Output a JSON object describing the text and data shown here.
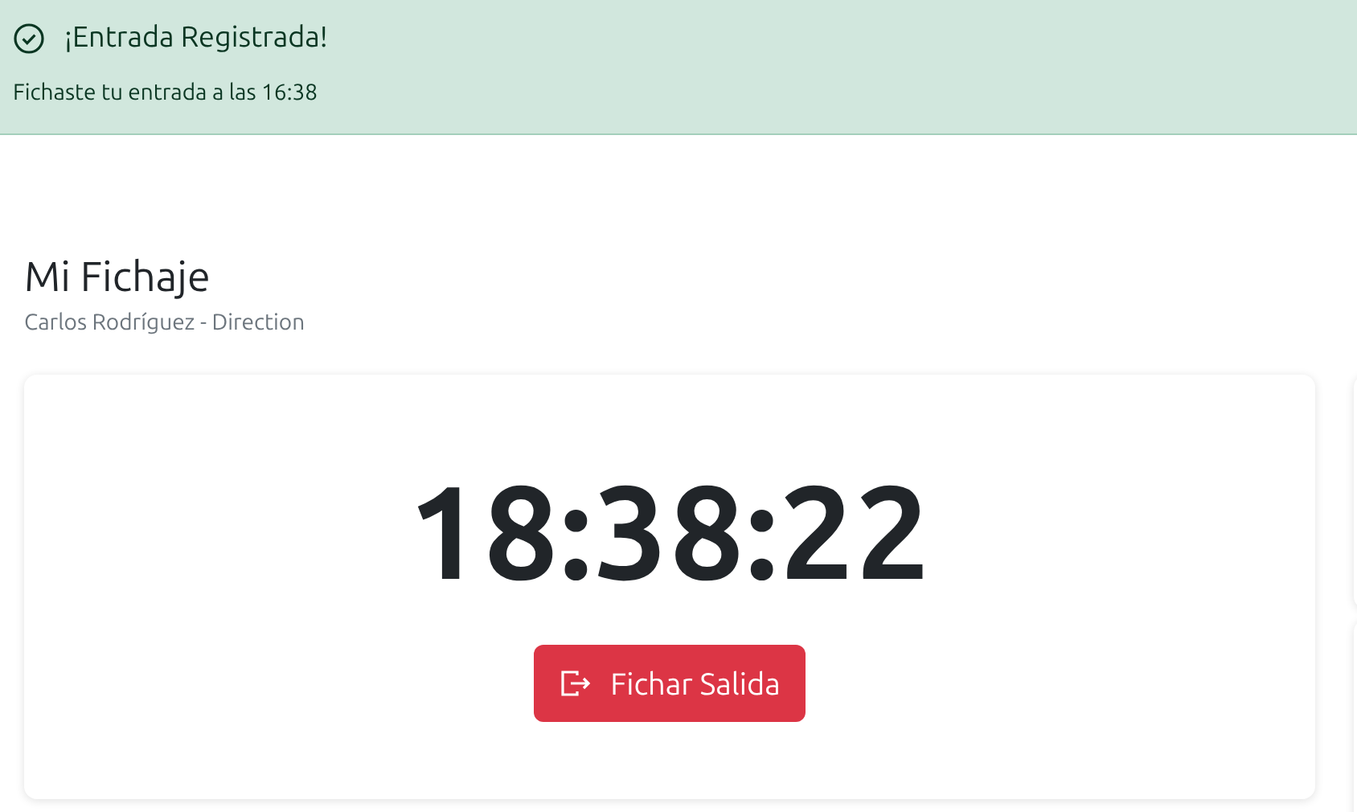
{
  "alert": {
    "title": "¡Entrada Registrada!",
    "message": "Fichaste tu entrada a las 16:38"
  },
  "header": {
    "title": "Mi Fichaje",
    "subtitle": "Carlos Rodríguez - Direction"
  },
  "clock": {
    "time": "18:38:22",
    "button": "Fichar Salida"
  }
}
